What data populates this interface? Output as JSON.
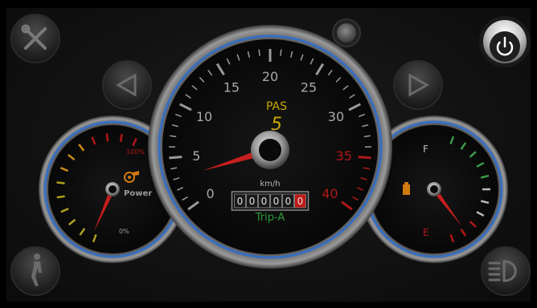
{
  "colors": {
    "accent_blue": "#2d6fd0",
    "needle_red": "#c81e1e",
    "pas_yellow": "#c8a800",
    "redline": "#b01818",
    "odometer_active": "#c01818",
    "trip_green": "#2f9a3a",
    "battery_orange": "#d07a10"
  },
  "icons": {
    "settings": "wrench-screwdriver-icon",
    "power": "power-icon",
    "left_signal": "left-turn-arrow-icon",
    "right_signal": "right-turn-arrow-icon",
    "walk_assist": "walking-person-icon",
    "headlight": "headlight-icon",
    "power_gauge": "engine-power-icon",
    "battery": "battery-icon",
    "status_light": "status-light-icon"
  },
  "speedometer": {
    "tick_labels": [
      "0",
      "5",
      "10",
      "15",
      "20",
      "25",
      "30",
      "35",
      "40"
    ],
    "min": 0,
    "max": 40,
    "redline_from": 35,
    "speed": 3,
    "pas_label": "PAS",
    "pas_level": "5",
    "unit": "km/h",
    "odometer_digits": [
      "0",
      "0",
      "0",
      "0",
      "0",
      "0"
    ],
    "trip_label": "Trip-A"
  },
  "power_gauge": {
    "label": "Power",
    "max_label": "100%",
    "min_label": "0%",
    "level": 0.02
  },
  "battery_gauge": {
    "full_label": "F",
    "empty_label": "E",
    "level": 0.12
  }
}
